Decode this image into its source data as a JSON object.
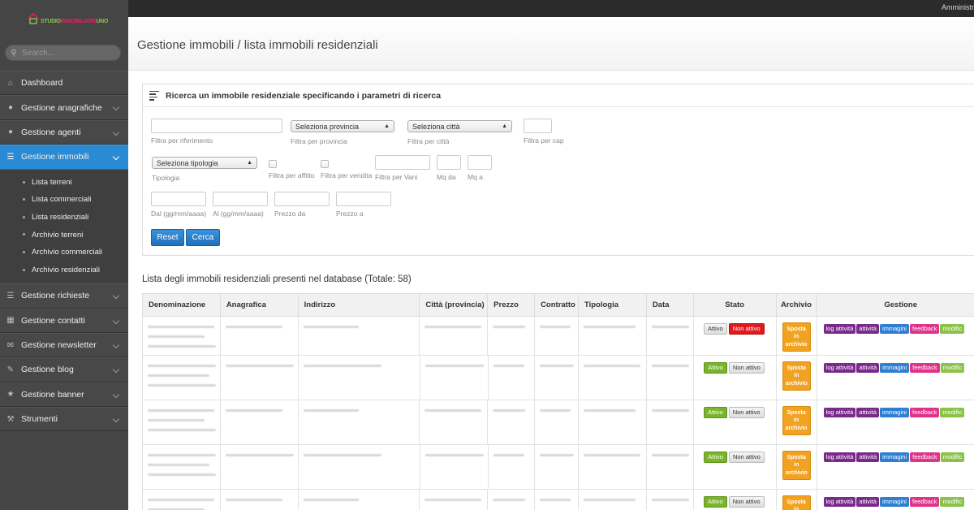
{
  "topbar": {
    "user": "Amministr"
  },
  "sidebar": {
    "logo": {
      "a": "STUDIO",
      "b": "IMMOBILIARE",
      "c": "UNO"
    },
    "search": {
      "placeholder": "Search..."
    },
    "menu_top": [
      {
        "label": "Dashboard",
        "icon": "home-icon",
        "chevron": false
      },
      {
        "label": "Gestione anagrafiche",
        "icon": "user-icon",
        "chevron": true
      },
      {
        "label": "Gestione agenti",
        "icon": "user-icon",
        "chevron": true
      },
      {
        "label": "Gestione immobili",
        "icon": "list-icon",
        "chevron": true,
        "active": true
      }
    ],
    "submenu": [
      "Lista terreni",
      "Lista commerciali",
      "Lista residenziali",
      "Archivio terreni",
      "Archivio commerciali",
      "Archivio residenziali"
    ],
    "menu_bottom": [
      {
        "label": "Gestione richieste",
        "icon": "list-icon"
      },
      {
        "label": "Gestione contatti",
        "icon": "book-icon"
      },
      {
        "label": "Gestione newsletter",
        "icon": "envelope-icon"
      },
      {
        "label": "Gestione blog",
        "icon": "blog-icon"
      },
      {
        "label": "Gestione banner",
        "icon": "star-icon"
      },
      {
        "label": "Strumenti",
        "icon": "wrench-icon"
      }
    ]
  },
  "page": {
    "title": "Gestione immobili / lista immobili residenziali",
    "search_title": "Ricerca un immobile residenziale specificando i parametri di ricerca",
    "filters": {
      "riferimento": "Filtra per riferimento",
      "provincia_select": "Seleziona provincia",
      "provincia": "Filtra per provincia",
      "citta_select": "Seleziona città",
      "citta": "Filtra per città",
      "cap": "Filtra per cap",
      "tipologia_select": "Seleziona tipologia",
      "tipologia": "Tipologia",
      "affitto": "Filtra per affitto",
      "vendita": "Filtra per vendita",
      "vani": "Filtra per Vani",
      "mq_da": "Mq da",
      "mq_a": "Mq a",
      "dal": "Dal (gg/mm/aaaa)",
      "al": "Al (gg/mm/aaaa)",
      "prezzo_da": "Prezzo da",
      "prezzo_a": "Prezzo a"
    },
    "buttons": {
      "reset": "Reset",
      "cerca": "Cerca"
    },
    "list_title": "Lista degli immobili residenziali presenti nel database (Totale: 58)",
    "table": {
      "headers": [
        "Denominazione",
        "Anagrafica",
        "Indirizzo",
        "Città (provincia)",
        "Prezzo",
        "Contratto",
        "Tipologia",
        "Data",
        "Stato",
        "Archivio",
        "Gestione"
      ],
      "stato_attivo": "Attivo",
      "stato_non_attivo": "Non attivo",
      "archivio_btn": [
        "Sposta",
        "in",
        "archivio"
      ],
      "gestione_btns": [
        "log attività",
        "attività",
        "immagini",
        "feedback",
        "modific"
      ],
      "rows": [
        {
          "active": false
        },
        {
          "active": true
        },
        {
          "active": true
        },
        {
          "active": true
        },
        {
          "active": true
        }
      ]
    }
  }
}
